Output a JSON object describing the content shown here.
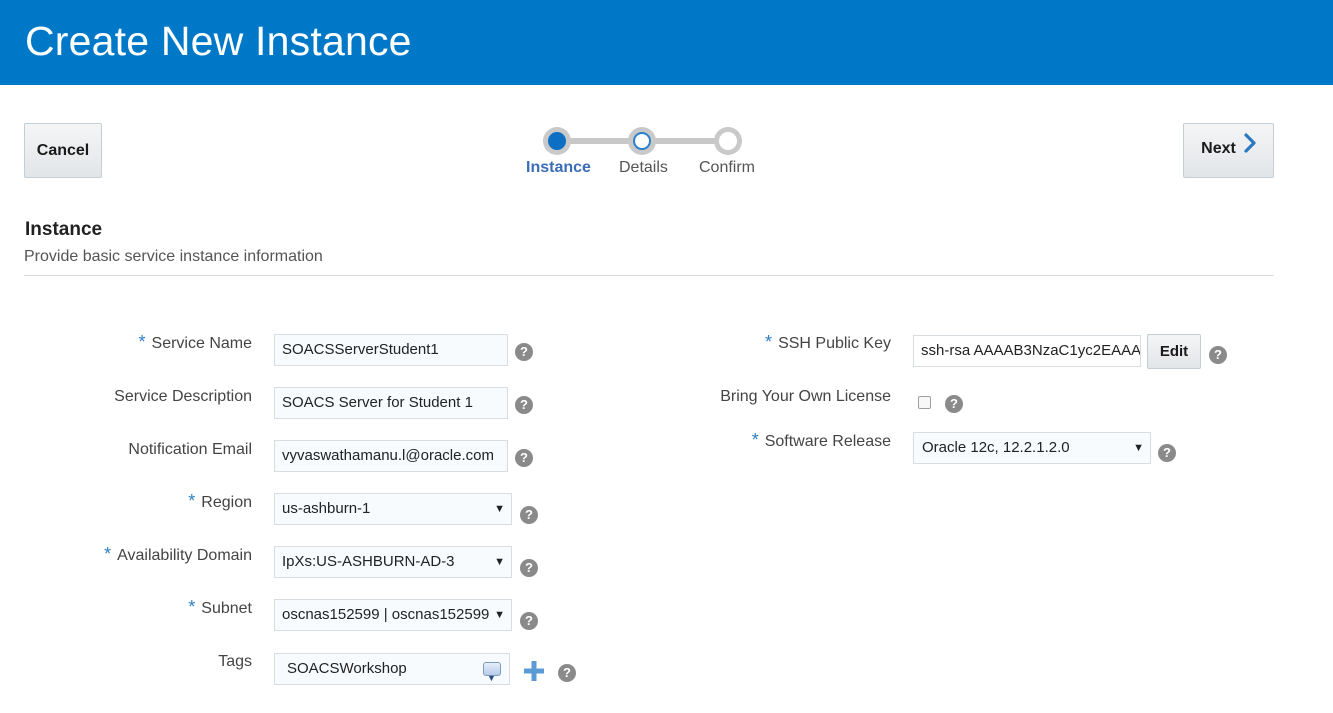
{
  "header": {
    "title": "Create New Instance"
  },
  "toolbar": {
    "cancel_label": "Cancel",
    "next_label": "Next"
  },
  "train": {
    "steps": [
      {
        "label": "Instance",
        "state": "active"
      },
      {
        "label": "Details",
        "state": "next"
      },
      {
        "label": "Confirm",
        "state": "unvisited"
      }
    ]
  },
  "section": {
    "title": "Instance",
    "subtitle": "Provide basic service instance information"
  },
  "form": {
    "service_name": {
      "label": "Service Name",
      "required": true,
      "value": "SOACSServerStudent1"
    },
    "service_description": {
      "label": "Service Description",
      "required": false,
      "value": "SOACS Server for Student 1"
    },
    "notification_email": {
      "label": "Notification Email",
      "required": false,
      "value": "vyvaswathamanu.l@oracle.com"
    },
    "region": {
      "label": "Region",
      "required": true,
      "value": "us-ashburn-1"
    },
    "availability_domain": {
      "label": "Availability Domain",
      "required": true,
      "value": "IpXs:US-ASHBURN-AD-3"
    },
    "subnet": {
      "label": "Subnet",
      "required": true,
      "value": "oscnas152599 | oscnas152599"
    },
    "tags": {
      "label": "Tags",
      "required": false,
      "value": "SOACSWorkshop"
    },
    "ssh_public_key": {
      "label": "SSH Public Key",
      "required": true,
      "value": "ssh-rsa AAAAB3NzaC1yc2EAAAA",
      "edit_label": "Edit"
    },
    "byol": {
      "label": "Bring Your Own License",
      "checked": false
    },
    "software_release": {
      "label": "Software Release",
      "required": true,
      "value": "Oracle 12c, 12.2.1.2.0"
    }
  },
  "help_glyph": "?",
  "required_glyph": "*",
  "colors": {
    "header": "#0078c8",
    "accent": "#2c7fc4",
    "active_step": "#3b6db7"
  }
}
